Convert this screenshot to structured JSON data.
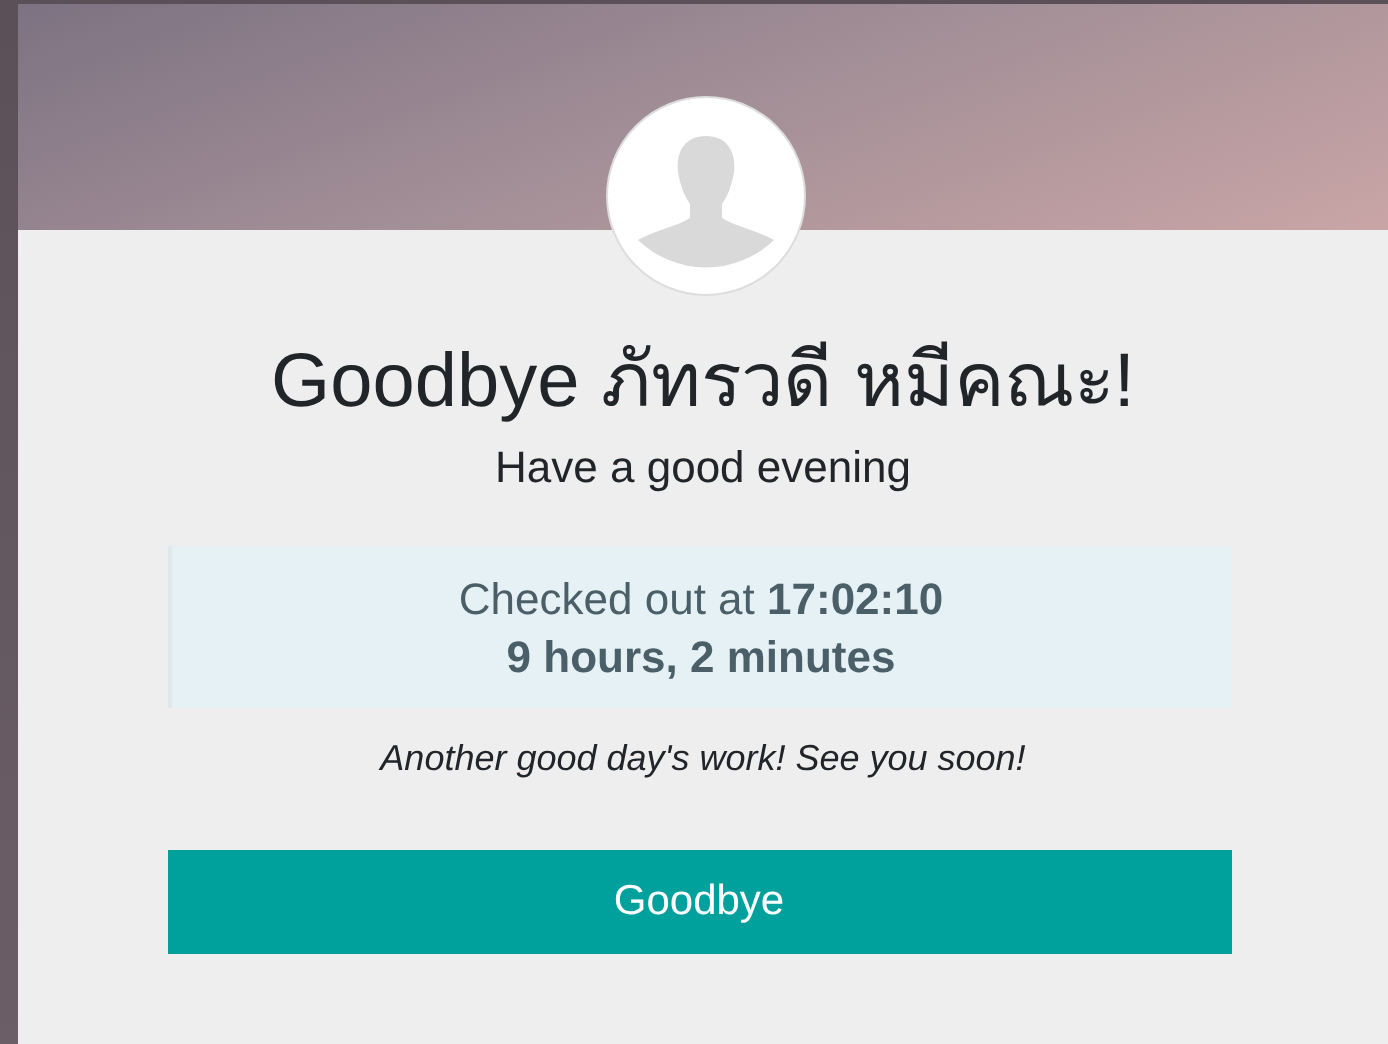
{
  "greeting": "Goodbye ภัทรวดี หมีคณะ!",
  "subtitle": "Have a good evening",
  "info": {
    "checked_out": "Checked out at **17:02:10**",
    "duration": "9 hours, 2 minutes"
  },
  "message": "Another good day's work! See you soon!",
  "button": "Goodbye"
}
